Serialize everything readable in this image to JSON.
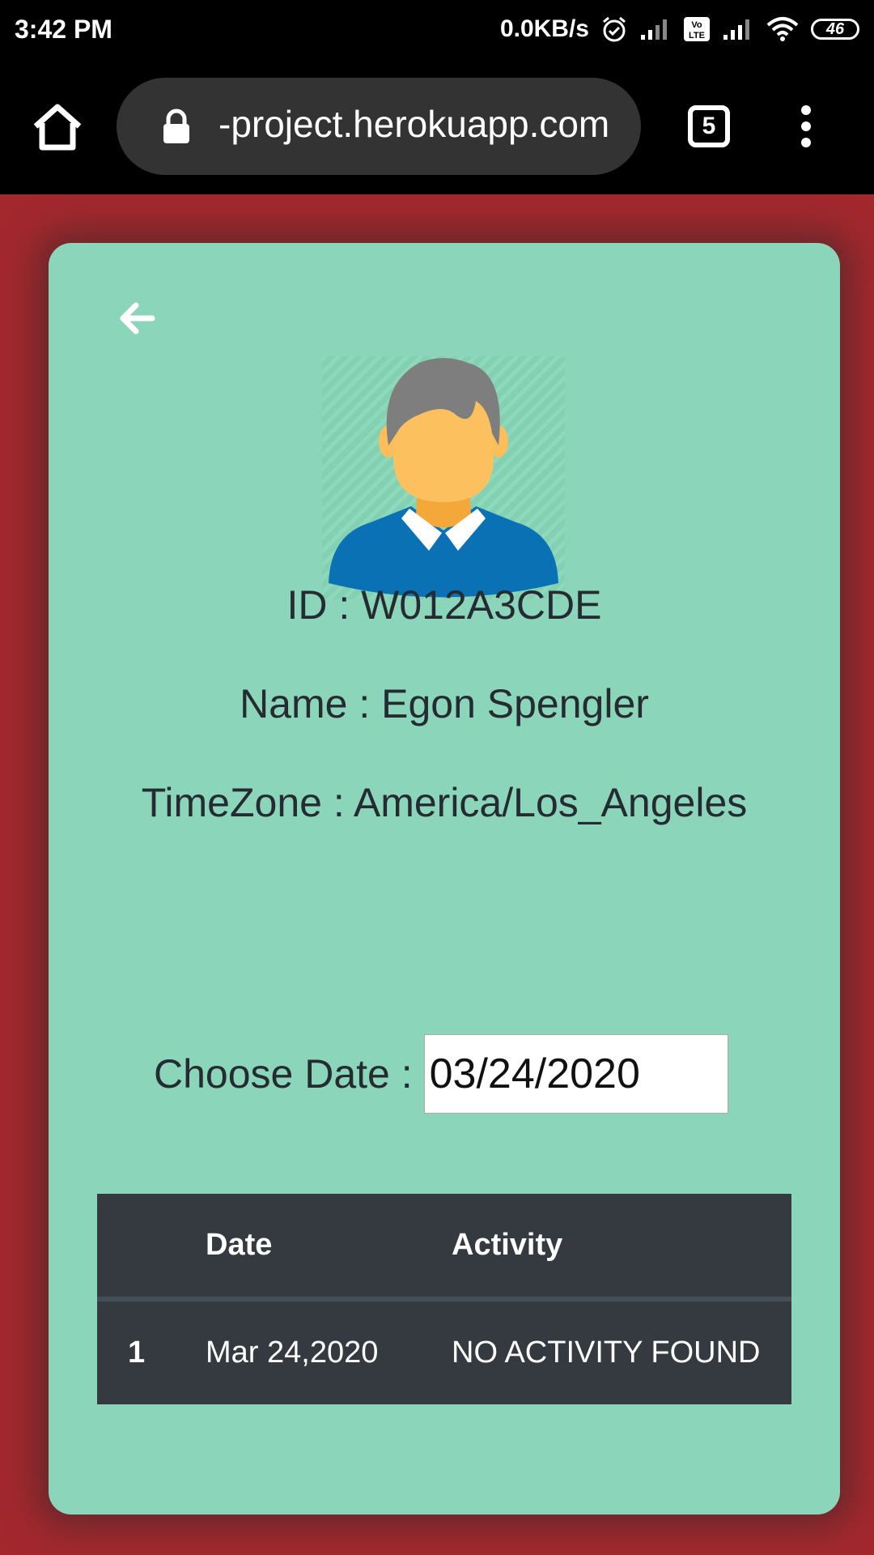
{
  "status_bar": {
    "time": "3:42 PM",
    "network_speed": "0.0KB/s",
    "battery_level": "46",
    "icons": [
      "alarm-icon",
      "signal-icon",
      "volte-icon",
      "signal-icon",
      "wifi-icon",
      "battery-icon"
    ]
  },
  "browser": {
    "url": "-project.herokuapp.com",
    "tab_count": "5",
    "icons": [
      "home-icon",
      "lock-icon",
      "tabs-icon",
      "more-vert-icon"
    ]
  },
  "profile": {
    "id_line": "ID : W012A3CDE",
    "name_line": "Name : Egon Spengler",
    "timezone_line": "TimeZone : America/Los_Angeles",
    "avatar_icon": "user-avatar-icon",
    "back_icon": "back-arrow-icon"
  },
  "date_picker": {
    "label": "Choose Date :",
    "value": "03/24/2020"
  },
  "activity_table": {
    "headers": [
      "",
      "Date",
      "Activity"
    ],
    "rows": [
      [
        "1",
        "Mar 24,2020",
        "NO ACTIVITY FOUND"
      ]
    ]
  },
  "colors": {
    "page_background": "#a2282e",
    "card_background": "#8bd6ba",
    "table_background": "#343a40",
    "text": "#252b30"
  }
}
